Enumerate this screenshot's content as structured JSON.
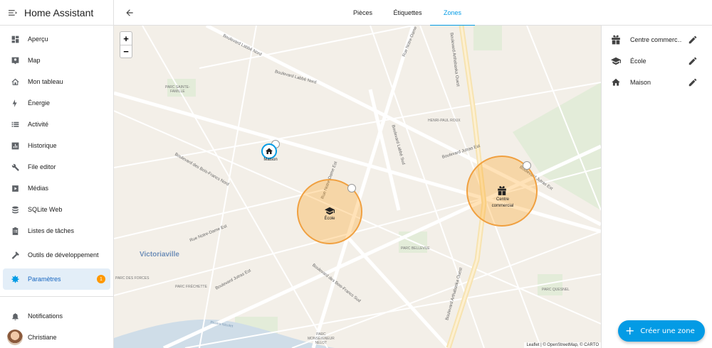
{
  "app": {
    "title": "Home Assistant"
  },
  "sidebar": {
    "items": [
      {
        "label": "Aperçu",
        "icon": "dashboard-icon"
      },
      {
        "label": "Map",
        "icon": "map-icon"
      },
      {
        "label": "Mon tableau",
        "icon": "home-outline-icon"
      },
      {
        "label": "Énergie",
        "icon": "lightning-icon"
      },
      {
        "label": "Activité",
        "icon": "list-icon"
      },
      {
        "label": "Historique",
        "icon": "chart-box-icon"
      },
      {
        "label": "File editor",
        "icon": "wrench-icon"
      },
      {
        "label": "Médias",
        "icon": "play-box-icon"
      },
      {
        "label": "SQLite Web",
        "icon": "database-icon"
      },
      {
        "label": "Listes de tâches",
        "icon": "clipboard-list-icon"
      },
      {
        "label": "Outils de développement",
        "icon": "hammer-icon"
      },
      {
        "label": "Paramètres",
        "icon": "gear-icon",
        "badge": "1"
      }
    ],
    "notifications": "Notifications",
    "user": "Christiane"
  },
  "tabs": [
    {
      "label": "Pièces"
    },
    {
      "label": "Étiquettes"
    },
    {
      "label": "Zones"
    }
  ],
  "map": {
    "zoom_in": "+",
    "zoom_out": "−",
    "labels": {
      "boulevard_labbe_nord_1": "Boulevard Labbé Nord",
      "boulevard_labbe_nord_2": "Boulevard Labbé Nord",
      "rue_notre_dame_est_1": "Rue Notre-Dame Est",
      "rue_notre_dame_est_2": "Rue Notre-Dame Est",
      "boulevard_arthabaska_ouest_1": "Boulevard Arthabaska Ouest",
      "boulevard_arthabaska_ouest_2": "Boulevard Arthabaska Ouest",
      "boulevard_labbe_sud": "Boulevard Labbé Sud",
      "boulevard_jutras_est_1": "Boulevard Jutras Est",
      "boulevard_jutras_est_2": "Boulevard Jutras Est",
      "boulevard_jutras_est_3": "Boulevard Jutras Est",
      "boulevard_bois_francs_nord": "Boulevard des Bois-Francs Nord",
      "boulevard_bois_francs_sud": "Boulevard des Bois-Francs Sud",
      "rue_notre_dame_est_3": "Rue Notre-Dame Est",
      "parc_sainte_famille_1": "PARC SAINTE-",
      "parc_sainte_famille_2": "FAMILLE",
      "henri_paul_roux": "HENRI-PAUL ROUX",
      "parc_bellevue": "PARC BELLEVUE",
      "victoriaville": "Victoriaville",
      "parc_des_forces": "PARC DES FORCES",
      "parc_frechette": "PARC FRÉCHETTE",
      "parc_quesnel": "PARC QUESNEL",
      "parc_monseigneur_1": "PARC",
      "parc_monseigneur_2": "MONSEIGNEUR",
      "parc_monseigneur_3": "NELOT",
      "riviere_nicolet": "Rivière Nicolet"
    },
    "markers": {
      "maison": "Maison",
      "ecole": "École",
      "centre_1": "Centre",
      "centre_2": "commercial"
    },
    "attribution": "Leaflet | © OpenStreetMap, © CARTO",
    "zone_color": "#ff9800",
    "home_color": "#039be5"
  },
  "zones": [
    {
      "name": "Centre commerc…",
      "icon": "gift-icon"
    },
    {
      "name": "École",
      "icon": "school-icon"
    },
    {
      "name": "Maison",
      "icon": "home-icon"
    }
  ],
  "fab": {
    "label": "Créer une zone",
    "plus": "+"
  }
}
